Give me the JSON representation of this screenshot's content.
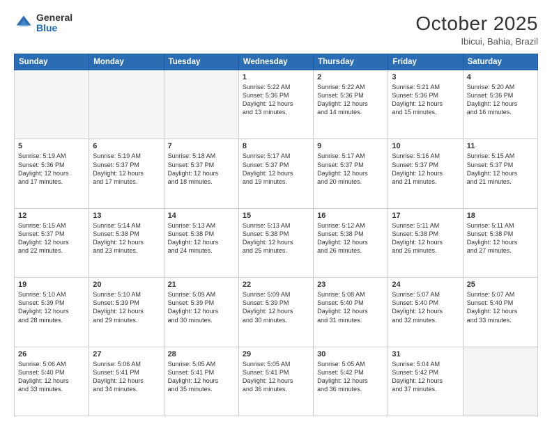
{
  "header": {
    "logo_general": "General",
    "logo_blue": "Blue",
    "month_title": "October 2025",
    "location": "Ibicui, Bahia, Brazil"
  },
  "weekdays": [
    "Sunday",
    "Monday",
    "Tuesday",
    "Wednesday",
    "Thursday",
    "Friday",
    "Saturday"
  ],
  "weeks": [
    [
      {
        "day": "",
        "info": ""
      },
      {
        "day": "",
        "info": ""
      },
      {
        "day": "",
        "info": ""
      },
      {
        "day": "1",
        "info": "Sunrise: 5:22 AM\nSunset: 5:36 PM\nDaylight: 12 hours\nand 13 minutes."
      },
      {
        "day": "2",
        "info": "Sunrise: 5:22 AM\nSunset: 5:36 PM\nDaylight: 12 hours\nand 14 minutes."
      },
      {
        "day": "3",
        "info": "Sunrise: 5:21 AM\nSunset: 5:36 PM\nDaylight: 12 hours\nand 15 minutes."
      },
      {
        "day": "4",
        "info": "Sunrise: 5:20 AM\nSunset: 5:36 PM\nDaylight: 12 hours\nand 16 minutes."
      }
    ],
    [
      {
        "day": "5",
        "info": "Sunrise: 5:19 AM\nSunset: 5:36 PM\nDaylight: 12 hours\nand 17 minutes."
      },
      {
        "day": "6",
        "info": "Sunrise: 5:19 AM\nSunset: 5:37 PM\nDaylight: 12 hours\nand 17 minutes."
      },
      {
        "day": "7",
        "info": "Sunrise: 5:18 AM\nSunset: 5:37 PM\nDaylight: 12 hours\nand 18 minutes."
      },
      {
        "day": "8",
        "info": "Sunrise: 5:17 AM\nSunset: 5:37 PM\nDaylight: 12 hours\nand 19 minutes."
      },
      {
        "day": "9",
        "info": "Sunrise: 5:17 AM\nSunset: 5:37 PM\nDaylight: 12 hours\nand 20 minutes."
      },
      {
        "day": "10",
        "info": "Sunrise: 5:16 AM\nSunset: 5:37 PM\nDaylight: 12 hours\nand 21 minutes."
      },
      {
        "day": "11",
        "info": "Sunrise: 5:15 AM\nSunset: 5:37 PM\nDaylight: 12 hours\nand 21 minutes."
      }
    ],
    [
      {
        "day": "12",
        "info": "Sunrise: 5:15 AM\nSunset: 5:37 PM\nDaylight: 12 hours\nand 22 minutes."
      },
      {
        "day": "13",
        "info": "Sunrise: 5:14 AM\nSunset: 5:38 PM\nDaylight: 12 hours\nand 23 minutes."
      },
      {
        "day": "14",
        "info": "Sunrise: 5:13 AM\nSunset: 5:38 PM\nDaylight: 12 hours\nand 24 minutes."
      },
      {
        "day": "15",
        "info": "Sunrise: 5:13 AM\nSunset: 5:38 PM\nDaylight: 12 hours\nand 25 minutes."
      },
      {
        "day": "16",
        "info": "Sunrise: 5:12 AM\nSunset: 5:38 PM\nDaylight: 12 hours\nand 26 minutes."
      },
      {
        "day": "17",
        "info": "Sunrise: 5:11 AM\nSunset: 5:38 PM\nDaylight: 12 hours\nand 26 minutes."
      },
      {
        "day": "18",
        "info": "Sunrise: 5:11 AM\nSunset: 5:38 PM\nDaylight: 12 hours\nand 27 minutes."
      }
    ],
    [
      {
        "day": "19",
        "info": "Sunrise: 5:10 AM\nSunset: 5:39 PM\nDaylight: 12 hours\nand 28 minutes."
      },
      {
        "day": "20",
        "info": "Sunrise: 5:10 AM\nSunset: 5:39 PM\nDaylight: 12 hours\nand 29 minutes."
      },
      {
        "day": "21",
        "info": "Sunrise: 5:09 AM\nSunset: 5:39 PM\nDaylight: 12 hours\nand 30 minutes."
      },
      {
        "day": "22",
        "info": "Sunrise: 5:09 AM\nSunset: 5:39 PM\nDaylight: 12 hours\nand 30 minutes."
      },
      {
        "day": "23",
        "info": "Sunrise: 5:08 AM\nSunset: 5:40 PM\nDaylight: 12 hours\nand 31 minutes."
      },
      {
        "day": "24",
        "info": "Sunrise: 5:07 AM\nSunset: 5:40 PM\nDaylight: 12 hours\nand 32 minutes."
      },
      {
        "day": "25",
        "info": "Sunrise: 5:07 AM\nSunset: 5:40 PM\nDaylight: 12 hours\nand 33 minutes."
      }
    ],
    [
      {
        "day": "26",
        "info": "Sunrise: 5:06 AM\nSunset: 5:40 PM\nDaylight: 12 hours\nand 33 minutes."
      },
      {
        "day": "27",
        "info": "Sunrise: 5:06 AM\nSunset: 5:41 PM\nDaylight: 12 hours\nand 34 minutes."
      },
      {
        "day": "28",
        "info": "Sunrise: 5:05 AM\nSunset: 5:41 PM\nDaylight: 12 hours\nand 35 minutes."
      },
      {
        "day": "29",
        "info": "Sunrise: 5:05 AM\nSunset: 5:41 PM\nDaylight: 12 hours\nand 36 minutes."
      },
      {
        "day": "30",
        "info": "Sunrise: 5:05 AM\nSunset: 5:42 PM\nDaylight: 12 hours\nand 36 minutes."
      },
      {
        "day": "31",
        "info": "Sunrise: 5:04 AM\nSunset: 5:42 PM\nDaylight: 12 hours\nand 37 minutes."
      },
      {
        "day": "",
        "info": ""
      }
    ]
  ]
}
